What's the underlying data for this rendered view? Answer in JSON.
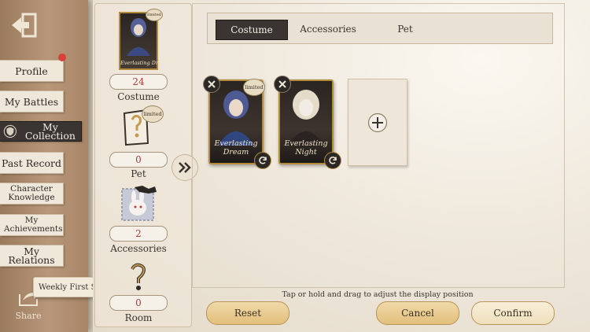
{
  "nav": {
    "items": [
      {
        "label": "Profile"
      },
      {
        "label": "My Battles"
      },
      {
        "label": "My Collection"
      },
      {
        "label": "Past Record"
      },
      {
        "label": "Character Knowledge"
      },
      {
        "label": "My Achievements"
      },
      {
        "label": "My Relations"
      }
    ],
    "share_label": "Share",
    "weekly_share_label": "Weekly First Share"
  },
  "summary": {
    "costume_card_name": "Everlasting Dream",
    "costume_count": "24",
    "costume_label": "Costume",
    "pet_count": "0",
    "pet_label": "Pet",
    "accessories_count": "2",
    "accessories_label": "Accessories",
    "room_count": "0",
    "room_label": "Room",
    "limited_badge": "limited"
  },
  "tabs": [
    "Costume",
    "Accessories",
    "Pet"
  ],
  "active_tab": "Costume",
  "cards": [
    {
      "name": "Everlasting Dream",
      "limited": "limited"
    },
    {
      "name": "Everlasting Night"
    }
  ],
  "hint": "Tap or hold and drag to adjust the display position",
  "buttons": {
    "reset": "Reset",
    "cancel": "Cancel",
    "confirm": "Confirm"
  },
  "colors": {
    "active_dark": "#3a3533",
    "count_red": "#b0393a",
    "gold_button": "#e2bf7c",
    "card_frame": "#b28b3d"
  }
}
